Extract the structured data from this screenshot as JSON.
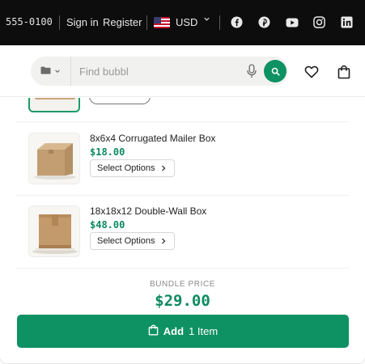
{
  "topbar": {
    "phone": "555-0100",
    "sign_in": "Sign in",
    "register": "Register",
    "currency": "USD",
    "currency_flag_icon": "us-flag-icon",
    "social_icons": [
      "facebook-icon",
      "pinterest-icon",
      "youtube-icon",
      "instagram-icon",
      "linkedin-icon"
    ],
    "background": "#0d0d0d"
  },
  "header": {
    "search_placeholder": "Find bubbl",
    "category_icon": "folder-icon",
    "mic_icon": "microphone-icon",
    "search_icon": "search-icon",
    "wishlist_icon": "heart-icon",
    "cart_icon": "shopping-bag-icon",
    "accent": "#0e9163"
  },
  "products": [
    {
      "name": "8x6x4 Corrugated Mailer Box",
      "price": "$18.00",
      "button": "Select Options"
    },
    {
      "name": "18x18x12 Double-Wall Box",
      "price": "$48.00",
      "button": "Select Options"
    }
  ],
  "bundle": {
    "label": "BUNDLE PRICE",
    "price": "$29.00",
    "add_label": "Add",
    "add_count": "1 Item"
  }
}
